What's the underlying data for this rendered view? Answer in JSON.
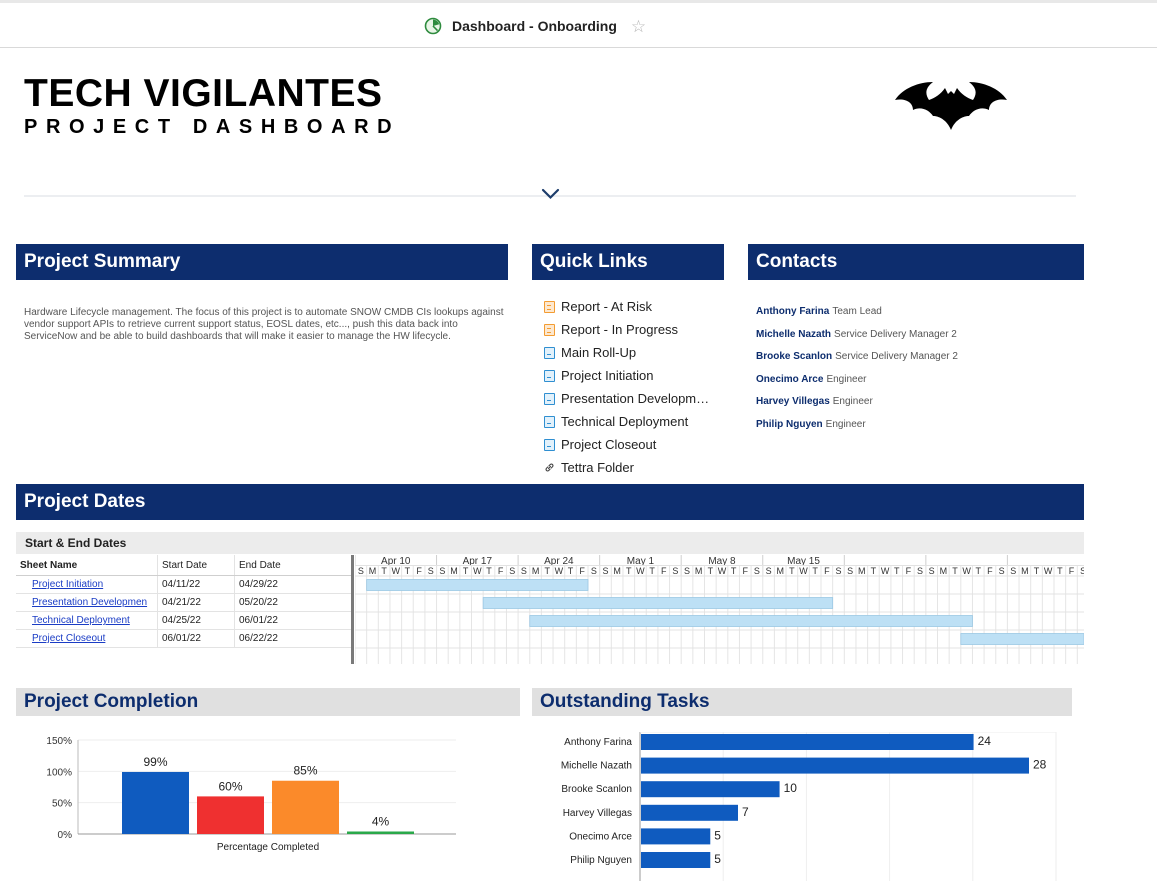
{
  "topbar": {
    "title": "Dashboard - Onboarding",
    "dashboard_icon": "dashboard-icon",
    "star_icon": "star-icon"
  },
  "brand": {
    "title": "TECH VIGILANTES",
    "subtitle": "PROJECT DASHBOARD",
    "logo": "bat-logo"
  },
  "sections": {
    "summary": "Project Summary",
    "quick_links": "Quick Links",
    "contacts": "Contacts",
    "dates": "Project Dates",
    "completion": "Project Completion",
    "outstanding": "Outstanding Tasks"
  },
  "summary_text": "Hardware Lifecycle management. The focus of this project is to automate SNOW CMDB CIs lookups against vendor support APIs to retrieve current support status, EOSL dates, etc..., push this data back into ServiceNow and be able to build dashboards that will make it easier to manage the HW lifecycle.",
  "quick_links": [
    {
      "label": "Report - At Risk",
      "icon": "report-icon"
    },
    {
      "label": "Report - In Progress",
      "icon": "report-icon"
    },
    {
      "label": "Main Roll-Up",
      "icon": "sheet-icon"
    },
    {
      "label": "Project Initiation",
      "icon": "sheet-icon"
    },
    {
      "label": "Presentation Developm…",
      "icon": "sheet-icon"
    },
    {
      "label": "Technical Deployment",
      "icon": "sheet-icon"
    },
    {
      "label": "Project Closeout",
      "icon": "sheet-icon"
    },
    {
      "label": "Tettra Folder",
      "icon": "link-icon"
    }
  ],
  "contacts": [
    {
      "name": "Anthony Farina",
      "role": "Team Lead"
    },
    {
      "name": "Michelle Nazath",
      "role": "Service Delivery Manager 2"
    },
    {
      "name": "Brooke Scanlon",
      "role": "Service Delivery Manager 2"
    },
    {
      "name": "Onecimo Arce",
      "role": "Engineer"
    },
    {
      "name": "Harvey Villegas",
      "role": "Engineer"
    },
    {
      "name": "Philip Nguyen",
      "role": "Engineer"
    }
  ],
  "gantt": {
    "label": "Start & End Dates",
    "headers": [
      "Sheet Name",
      "Start Date",
      "End Date"
    ],
    "rows": [
      {
        "name": "Project Initiation",
        "start": "04/11/22",
        "end": "04/29/22"
      },
      {
        "name": "Presentation Developmen",
        "start": "04/21/22",
        "end": "05/20/22"
      },
      {
        "name": "Technical Deployment",
        "start": "04/25/22",
        "end": "06/01/22"
      },
      {
        "name": "Project Closeout",
        "start": "06/01/22",
        "end": "06/22/22"
      }
    ],
    "week_labels": [
      "Apr 10",
      "Apr 17",
      "Apr 24",
      "May 1",
      "May 8",
      "May 15"
    ],
    "day_letters": [
      "S",
      "M",
      "T",
      "W",
      "T",
      "F",
      "S"
    ],
    "bar_color": "#bde0f5"
  },
  "chart_data": [
    {
      "type": "bar",
      "xlabel": "Percentage Completed",
      "ylabel": "",
      "ylim": [
        0,
        150
      ],
      "yticks": [
        "0%",
        "50%",
        "100%",
        "150%"
      ],
      "categories": [
        "",
        "",
        "",
        ""
      ],
      "values": [
        99,
        60,
        85,
        4
      ],
      "data_labels": [
        "99%",
        "60%",
        "85%",
        "4%"
      ],
      "colors": [
        "#0f5bbf",
        "#ef3030",
        "#fb8a2a",
        "#2aa84a"
      ]
    },
    {
      "type": "bar",
      "orientation": "horizontal",
      "categories": [
        "Anthony Farina",
        "Michelle Nazath",
        "Brooke Scanlon",
        "Harvey Villegas",
        "Onecimo Arce",
        "Philip Nguyen"
      ],
      "values": [
        24,
        28,
        10,
        7,
        5,
        5
      ],
      "color": "#0f5bbf"
    }
  ]
}
